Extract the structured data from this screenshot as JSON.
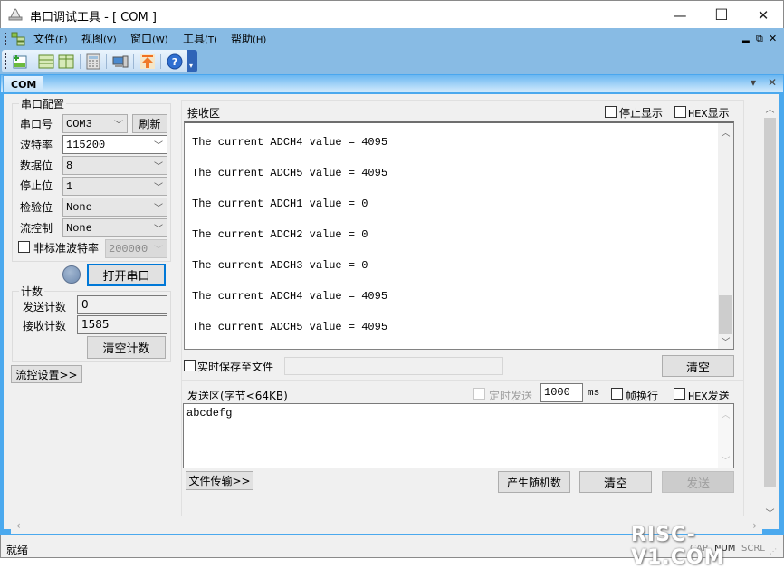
{
  "window": {
    "title": "串口调试工具 - [ COM ]",
    "controls": {
      "minimize": "—",
      "maximize": "☐",
      "close": "✕"
    }
  },
  "menubar": {
    "items": [
      {
        "label": "文件",
        "accel": "(F)"
      },
      {
        "label": "视图",
        "accel": "(V)"
      },
      {
        "label": "窗口",
        "accel": "(W)"
      },
      {
        "label": "工具",
        "accel": "(T)"
      },
      {
        "label": "帮助",
        "accel": "(H)"
      }
    ],
    "mdi_controls": {
      "minimize": "▂",
      "restore": "⧉",
      "close": "✕"
    }
  },
  "toolbar": {
    "icons": [
      "new-window-icon",
      "horizontal-split-icon",
      "vertical-split-icon",
      "calculator-icon",
      "computer-icon",
      "upload-icon",
      "help-icon"
    ]
  },
  "tabs": [
    {
      "label": "COM",
      "active": true
    }
  ],
  "tabstrip_controls": {
    "dropdown": "▾",
    "close": "✕"
  },
  "serial_config": {
    "group_label": "串口配置",
    "port": {
      "label": "串口号",
      "value": "COM3"
    },
    "refresh_label": "刷新",
    "baud": {
      "label": "波特率",
      "value": "115200"
    },
    "data_bits": {
      "label": "数据位",
      "value": "8"
    },
    "stop_bits": {
      "label": "停止位",
      "value": "1"
    },
    "parity": {
      "label": "检验位",
      "value": "None"
    },
    "flow": {
      "label": "流控制",
      "value": "None"
    },
    "custom_baud": {
      "label": "非标准波特率",
      "value": "200000",
      "checked": false
    }
  },
  "open_port_label": "打开串口",
  "counter": {
    "group_label": "计数",
    "sent_label": "发送计数",
    "sent_value": "0",
    "recv_label": "接收计数",
    "recv_value": "1585",
    "clear_label": "清空计数"
  },
  "flow_settings_label": "流控设置>>",
  "receive": {
    "title": "接收区",
    "stop_display": {
      "label": "停止显示",
      "checked": false
    },
    "hex_display": {
      "label": "HEX显示",
      "checked": false
    },
    "lines": [
      "The current ADCH4 value = 4095",
      "The current ADCH5 value = 4095",
      "The current ADCH1 value = 0",
      "The current ADCH2 value = 0",
      "The current ADCH3 value = 0",
      "The current ADCH4 value = 4095",
      "The current ADCH5 value = 4095"
    ],
    "save_to_file": {
      "label": "实时保存至文件",
      "checked": false,
      "path": ""
    },
    "clear_label": "清空"
  },
  "send": {
    "title": "发送区(字节<64KB)",
    "timed_send": {
      "label": "定时发送",
      "checked": false,
      "enabled": false
    },
    "interval_value": "1000",
    "interval_unit": "ms",
    "newline": {
      "label": "帧换行",
      "checked": false
    },
    "hex_send": {
      "label": "HEX发送",
      "checked": false
    },
    "text": "abcdefg",
    "file_transfer_label": "文件传输>>",
    "random_label": "产生随机数",
    "clear_label": "清空",
    "send_label": "发送"
  },
  "statusbar": {
    "status": "就绪",
    "indicators": [
      "CAP",
      "NUM",
      "SCRL"
    ]
  },
  "watermark": "RISC-V1.COM"
}
